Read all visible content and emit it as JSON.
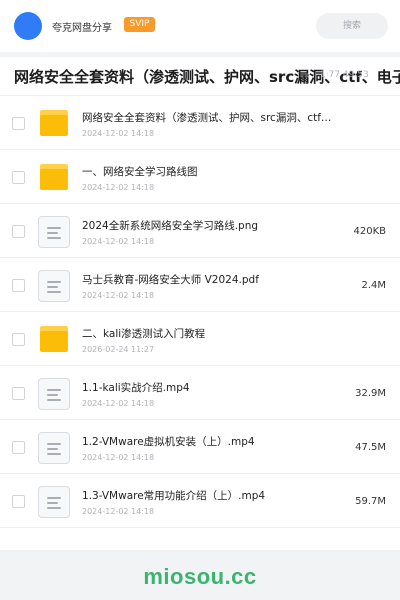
{
  "header": {
    "sharer": "夸克网盘分享",
    "badge": "SVIP",
    "search_label": "搜索"
  },
  "title_bar": {
    "title": "网络安全全套资料（渗透测试、护网、src漏洞、ctf、电子",
    "meta": "1·77 49·53"
  },
  "files": [
    {
      "type": "folder",
      "icon": "folder-icon",
      "name": "网络安全全套资料（渗透测试、护网、src漏洞、ctf、电子书、…",
      "date": "2024-12-02 14:18",
      "size": ""
    },
    {
      "type": "folder",
      "icon": "folder-icon",
      "name": "一、网络安全学习路线图",
      "date": "2024-12-02 14:18",
      "size": ""
    },
    {
      "type": "file",
      "icon": "document-icon",
      "name": "2024全新系统网络安全学习路线.png",
      "date": "2024-12-02 14:18",
      "size": "420KB"
    },
    {
      "type": "file",
      "icon": "document-icon",
      "name": "马士兵教育-网络安全大师 V2024.pdf",
      "date": "2024-12-02 14:18",
      "size": "2.4M"
    },
    {
      "type": "folder",
      "icon": "folder-icon",
      "name": "二、kali渗透测试入门教程",
      "date": "2026-02-24 11:27",
      "size": ""
    },
    {
      "type": "file",
      "icon": "document-icon",
      "name": "1.1-kali实战介绍.mp4",
      "date": "2024-12-02 14:18",
      "size": "32.9M"
    },
    {
      "type": "file",
      "icon": "document-icon",
      "name": "1.2-VMware虚拟机安装（上）.mp4",
      "date": "2024-12-02 14:18",
      "size": "47.5M"
    },
    {
      "type": "file",
      "icon": "document-icon",
      "name": "1.3-VMware常用功能介绍（上）.mp4",
      "date": "2024-12-02 14:18",
      "size": "59.7M"
    }
  ],
  "watermark": "miosou.cc",
  "colors": {
    "accent": "#2f7cf6",
    "svip": "#f79a2a",
    "folder": "#fbbd08",
    "watermark": "#3cb371"
  }
}
